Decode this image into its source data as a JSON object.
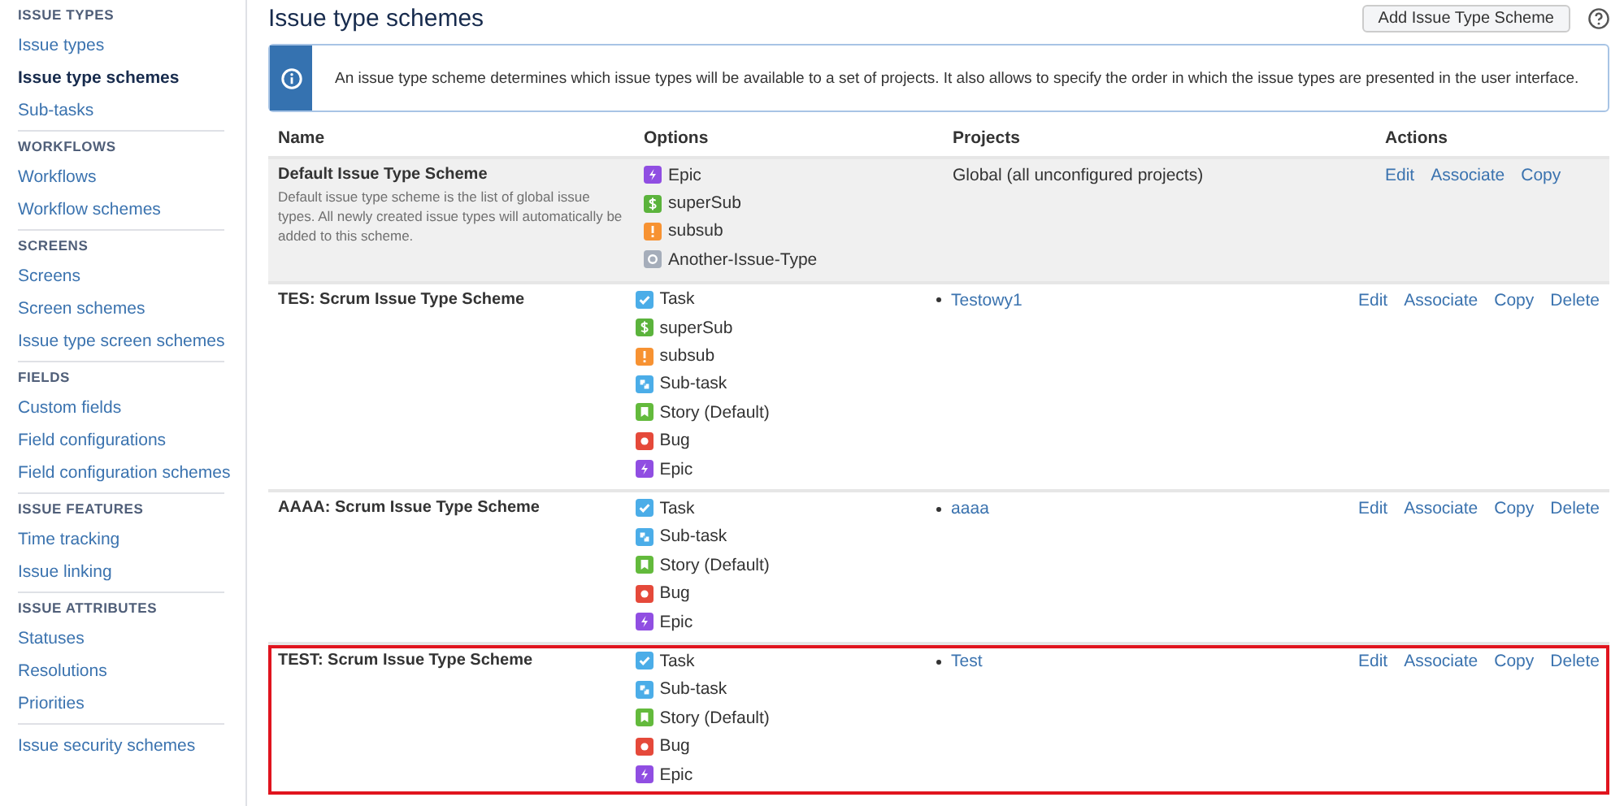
{
  "sidebar": {
    "sections": [
      {
        "heading": "ISSUE TYPES",
        "items": [
          {
            "label": "Issue types",
            "selected": false
          },
          {
            "label": "Issue type schemes",
            "selected": true
          },
          {
            "label": "Sub-tasks",
            "selected": false
          }
        ]
      },
      {
        "heading": "WORKFLOWS",
        "items": [
          {
            "label": "Workflows",
            "selected": false
          },
          {
            "label": "Workflow schemes",
            "selected": false
          }
        ]
      },
      {
        "heading": "SCREENS",
        "items": [
          {
            "label": "Screens",
            "selected": false
          },
          {
            "label": "Screen schemes",
            "selected": false
          },
          {
            "label": "Issue type screen schemes",
            "selected": false
          }
        ]
      },
      {
        "heading": "FIELDS",
        "items": [
          {
            "label": "Custom fields",
            "selected": false
          },
          {
            "label": "Field configurations",
            "selected": false
          },
          {
            "label": "Field configuration schemes",
            "selected": false
          }
        ]
      },
      {
        "heading": "ISSUE FEATURES",
        "items": [
          {
            "label": "Time tracking",
            "selected": false
          },
          {
            "label": "Issue linking",
            "selected": false
          }
        ]
      },
      {
        "heading": "ISSUE ATTRIBUTES",
        "items": [
          {
            "label": "Statuses",
            "selected": false
          },
          {
            "label": "Resolutions",
            "selected": false
          },
          {
            "label": "Priorities",
            "selected": false
          }
        ]
      },
      {
        "items": [
          {
            "label": "Issue security schemes",
            "selected": false
          }
        ]
      }
    ]
  },
  "page": {
    "title": "Issue type schemes",
    "add_button": "Add Issue Type Scheme"
  },
  "info": {
    "text": "An issue type scheme determines which issue types will be available to a set of projects. It also allows to specify the order in which the issue types are presented in the user interface."
  },
  "table": {
    "columns": [
      "Name",
      "Options",
      "Projects",
      "Actions"
    ],
    "rows": [
      {
        "name": "Default Issue Type Scheme",
        "description": "Default issue type scheme is the list of global issue types. All newly created issue types will automatically be added to this scheme.",
        "default": true,
        "highlighted": false,
        "options": [
          {
            "kind": "epic",
            "label": "Epic"
          },
          {
            "kind": "dollar",
            "label": "superSub"
          },
          {
            "kind": "alert",
            "label": "subsub"
          },
          {
            "kind": "generic",
            "label": "Another-Issue-Type"
          }
        ],
        "projects_text": "Global (all unconfigured projects)",
        "actions": [
          "Edit",
          "Associate",
          "Copy"
        ]
      },
      {
        "name": "TES: Scrum Issue Type Scheme",
        "default": false,
        "highlighted": false,
        "options": [
          {
            "kind": "task",
            "label": "Task"
          },
          {
            "kind": "dollar",
            "label": "superSub"
          },
          {
            "kind": "alert",
            "label": "subsub"
          },
          {
            "kind": "subtask",
            "label": "Sub-task"
          },
          {
            "kind": "story",
            "label": "Story (Default)"
          },
          {
            "kind": "bug",
            "label": "Bug"
          },
          {
            "kind": "epic",
            "label": "Epic"
          }
        ],
        "projects": [
          "Testowy1"
        ],
        "actions": [
          "Edit",
          "Associate",
          "Copy",
          "Delete"
        ]
      },
      {
        "name": "AAAA: Scrum Issue Type Scheme",
        "default": false,
        "highlighted": false,
        "options": [
          {
            "kind": "task",
            "label": "Task"
          },
          {
            "kind": "subtask",
            "label": "Sub-task"
          },
          {
            "kind": "story",
            "label": "Story (Default)"
          },
          {
            "kind": "bug",
            "label": "Bug"
          },
          {
            "kind": "epic",
            "label": "Epic"
          }
        ],
        "projects": [
          "aaaa"
        ],
        "actions": [
          "Edit",
          "Associate",
          "Copy",
          "Delete"
        ]
      },
      {
        "name": "TEST: Scrum Issue Type Scheme",
        "default": false,
        "highlighted": true,
        "options": [
          {
            "kind": "task",
            "label": "Task"
          },
          {
            "kind": "subtask",
            "label": "Sub-task"
          },
          {
            "kind": "story",
            "label": "Story (Default)"
          },
          {
            "kind": "bug",
            "label": "Bug"
          },
          {
            "kind": "epic",
            "label": "Epic"
          }
        ],
        "projects": [
          "Test"
        ],
        "actions": [
          "Edit",
          "Associate",
          "Copy",
          "Delete"
        ]
      }
    ]
  }
}
